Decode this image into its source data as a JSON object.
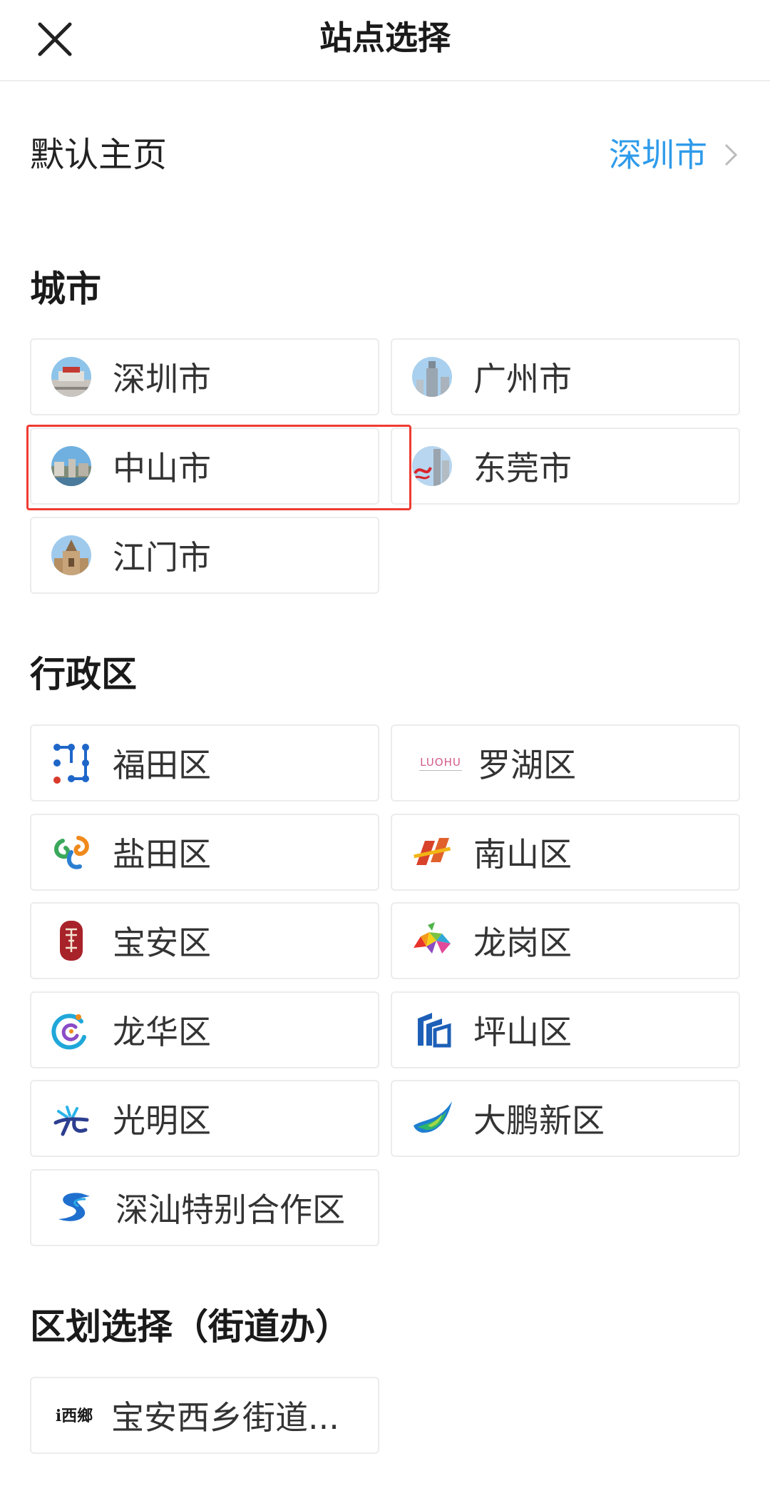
{
  "header": {
    "title": "站点选择",
    "close_icon": "close-icon"
  },
  "default_home": {
    "label": "默认主页",
    "value": "深圳市",
    "value_color": "#2f9bea"
  },
  "sections": {
    "cities": {
      "title": "城市",
      "items": [
        {
          "label": "深圳市",
          "icon": "shenzhen-city-photo-icon"
        },
        {
          "label": "广州市",
          "icon": "guangzhou-tower-photo-icon"
        },
        {
          "label": "中山市",
          "icon": "zhongshan-city-photo-icon"
        },
        {
          "label": "东莞市",
          "icon": "dongguan-city-photo-icon"
        },
        {
          "label": "江门市",
          "icon": "jiangmen-building-photo-icon"
        }
      ]
    },
    "districts": {
      "title": "行政区",
      "items": [
        {
          "label": "福田区",
          "icon": "futian-logo-icon"
        },
        {
          "label": "罗湖区",
          "icon": "luohu-logo-icon",
          "icon_text": "LUOHU"
        },
        {
          "label": "盐田区",
          "icon": "yantian-logo-icon"
        },
        {
          "label": "南山区",
          "icon": "nanshan-logo-icon"
        },
        {
          "label": "宝安区",
          "icon": "baoan-seal-icon"
        },
        {
          "label": "龙岗区",
          "icon": "longgang-logo-icon"
        },
        {
          "label": "龙华区",
          "icon": "longhua-logo-icon"
        },
        {
          "label": "坪山区",
          "icon": "pingshan-logo-icon"
        },
        {
          "label": "光明区",
          "icon": "guangming-logo-icon"
        },
        {
          "label": "大鹏新区",
          "icon": "dapeng-bird-logo-icon"
        },
        {
          "label": "深汕特别合作区",
          "icon": "shenshan-logo-icon"
        }
      ]
    },
    "streets": {
      "title": "区划选择（街道办）",
      "items": [
        {
          "label": "宝安西乡街道...",
          "icon": "xixiang-logo-icon",
          "icon_text": "i西鄉"
        }
      ]
    }
  },
  "highlight": {
    "target": "中山市",
    "color": "#ef3b32"
  }
}
